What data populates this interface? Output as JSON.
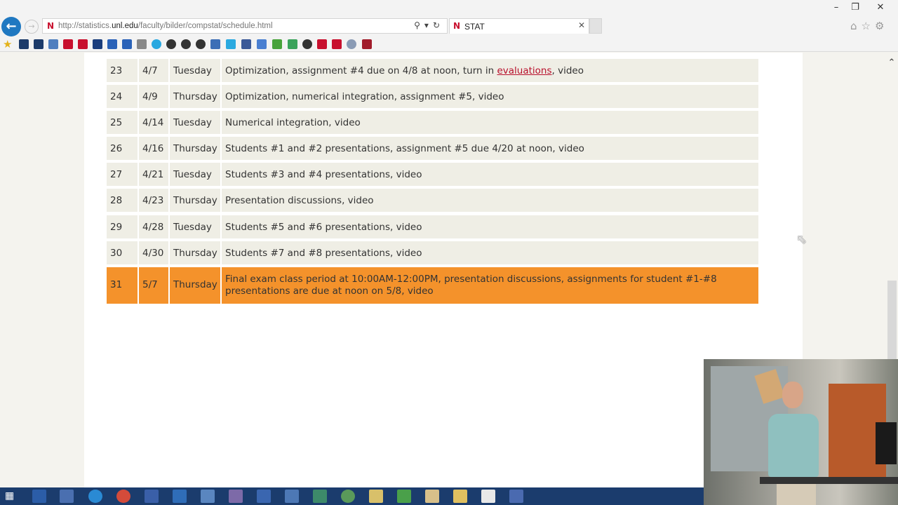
{
  "browser": {
    "url_prefix": "http://statistics.",
    "url_domain": "unl.edu",
    "url_suffix": "/faculty/bilder/compstat/schedule.html",
    "tab_title": "STAT"
  },
  "schedule": {
    "rows": [
      {
        "num": "23",
        "date": "4/7",
        "day": "Tuesday",
        "topic_pre": "Optimization, assignment #4 due on 4/8 at noon, turn in ",
        "topic_link": "evaluations",
        "topic_post": ", video"
      },
      {
        "num": "24",
        "date": "4/9",
        "day": "Thursday",
        "topic": "Optimization, numerical integration, assignment #5, video"
      },
      {
        "num": "25",
        "date": "4/14",
        "day": "Tuesday",
        "topic": "Numerical integration, video"
      },
      {
        "num": "26",
        "date": "4/16",
        "day": "Thursday",
        "topic": "Students #1 and #2 presentations, assignment #5 due 4/20 at noon, video"
      },
      {
        "num": "27",
        "date": "4/21",
        "day": "Tuesday",
        "topic": "Students #3 and #4 presentations, video"
      },
      {
        "num": "28",
        "date": "4/23",
        "day": "Thursday",
        "topic": "Presentation discussions, video"
      },
      {
        "num": "29",
        "date": "4/28",
        "day": "Tuesday",
        "topic": "Students #5 and #6 presentations, video"
      },
      {
        "num": "30",
        "date": "4/30",
        "day": "Thursday",
        "topic": "Students #7 and #8 presentations, video"
      },
      {
        "num": "31",
        "date": "5/7",
        "day": "Thursday",
        "topic_line1": "Final exam class period at 10:00AM-12:00PM, presentation discussions, assignments for student #1-#8",
        "topic_line2": "presentations are due at noon on 5/8, video"
      }
    ]
  },
  "colors": {
    "row_bg": "#efeee5",
    "highlight_bg": "#f4922b",
    "link": "#b8102c",
    "taskbar": "#1b3c6d"
  }
}
